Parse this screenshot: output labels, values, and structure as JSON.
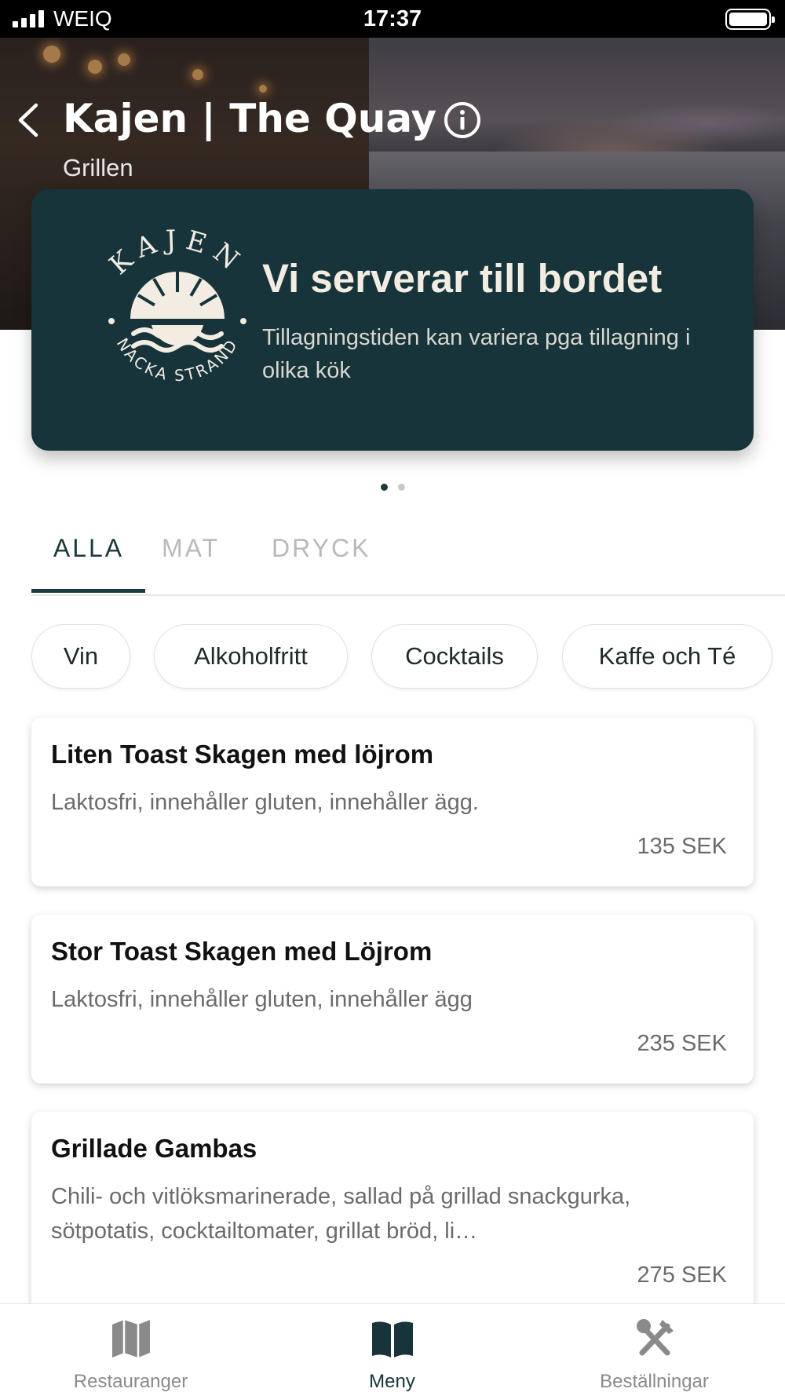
{
  "status_bar": {
    "carrier": "WEIQ",
    "time": "17:37"
  },
  "header": {
    "title": "Kajen | The Quay",
    "subtitle": "Grillen"
  },
  "banner": {
    "logo_top_text": "KAJEN",
    "logo_bottom_text": "NACKA STRAND",
    "title": "Vi serverar till bordet",
    "text": "Tillagningstiden kan variera pga tillagning i olika kök",
    "page_count": 2,
    "active_page": 1
  },
  "tabs": [
    {
      "label": "ALLA",
      "active": true
    },
    {
      "label": "MAT",
      "active": false
    },
    {
      "label": "DRYCK",
      "active": false
    }
  ],
  "chips": [
    {
      "label": "Vin"
    },
    {
      "label": "Alkoholfritt"
    },
    {
      "label": "Cocktails"
    },
    {
      "label": "Kaffe och Té"
    }
  ],
  "items": [
    {
      "name": "Liten Toast Skagen med löjrom",
      "description": "Laktosfri, innehåller gluten, innehåller ägg.",
      "price": "135 SEK"
    },
    {
      "name": "Stor Toast Skagen med Löjrom",
      "description": "Laktosfri, innehåller gluten, innehåller ägg",
      "price": "235 SEK"
    },
    {
      "name": "Grillade Gambas",
      "description": "Chili- och vitlöksmarinerade, sallad på grillad snackgurka, sötpotatis, cocktailtomater, grillat bröd, li…",
      "price": "275 SEK"
    }
  ],
  "bottom_nav": [
    {
      "label": "Restauranger",
      "icon": "map-icon",
      "active": false
    },
    {
      "label": "Meny",
      "icon": "book-icon",
      "active": true
    },
    {
      "label": "Beställningar",
      "icon": "utensils-icon",
      "active": false
    }
  ],
  "colors": {
    "brand_dark": "#17343a",
    "inactive": "#b9b9b9",
    "nav_inactive": "#8a8a8a"
  }
}
